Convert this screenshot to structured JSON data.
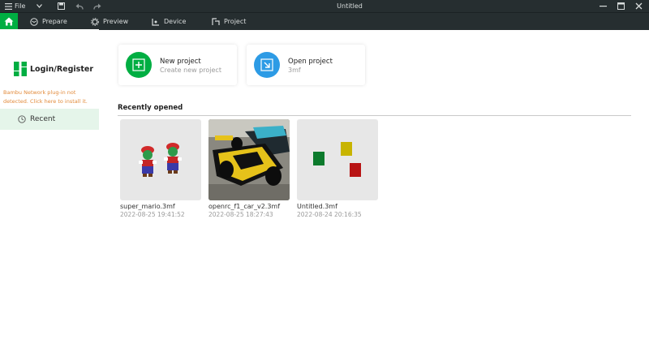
{
  "titlebar": {
    "menu_label": "File",
    "window_title": "Untitled"
  },
  "nav": {
    "tabs": [
      {
        "label": "Prepare"
      },
      {
        "label": "Preview"
      },
      {
        "label": "Device"
      },
      {
        "label": "Project"
      }
    ]
  },
  "sidebar": {
    "login_label": "Login/Register",
    "warning_text": "Bambu Network plug-in not detected. Click here to install it.",
    "recent_label": "Recent"
  },
  "actions": {
    "new_project": {
      "title": "New project",
      "subtitle": "Create new project"
    },
    "open_project": {
      "title": "Open project",
      "subtitle": "3mf"
    }
  },
  "recent": {
    "heading": "Recently opened",
    "files": [
      {
        "name": "super_mario.3mf",
        "date": "2022-08-25 19:41:52"
      },
      {
        "name": "openrc_f1_car_v2.3mf",
        "date": "2022-08-25 18:27:43"
      },
      {
        "name": "Untitled.3mf",
        "date": "2022-08-24 20:16:35"
      }
    ]
  },
  "colors": {
    "accent": "#00ae42",
    "open_blue": "#2d9be5",
    "topbar": "#262e30",
    "warning": "#e28a3a"
  }
}
